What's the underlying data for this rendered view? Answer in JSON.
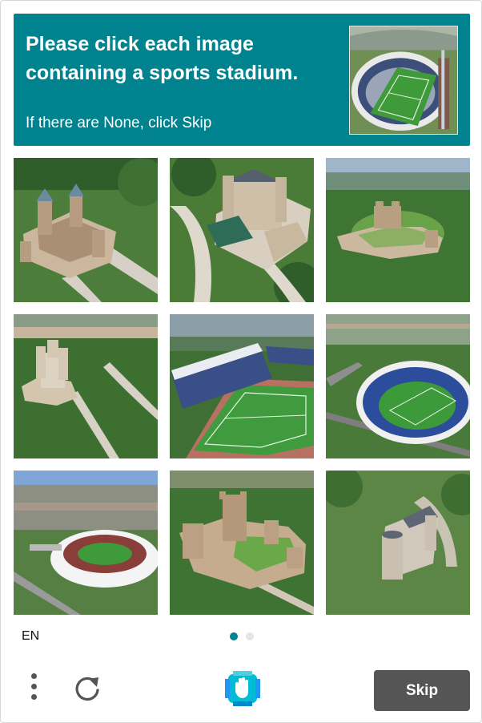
{
  "prompt": {
    "title": "Please click each image containing a sports stadium.",
    "subtitle": "If there are None, click Skip",
    "example_icon": "stadium-example-image"
  },
  "tiles": [
    {
      "subject": "castle",
      "icon": "castle-image"
    },
    {
      "subject": "castle",
      "icon": "castle-image"
    },
    {
      "subject": "castle",
      "icon": "castle-image"
    },
    {
      "subject": "castle",
      "icon": "castle-image"
    },
    {
      "subject": "stadium",
      "icon": "stadium-image"
    },
    {
      "subject": "stadium",
      "icon": "stadium-image"
    },
    {
      "subject": "stadium",
      "icon": "stadium-image"
    },
    {
      "subject": "castle",
      "icon": "castle-image"
    },
    {
      "subject": "castle",
      "icon": "castle-image"
    }
  ],
  "footer": {
    "language": "EN",
    "page_dots": {
      "count": 2,
      "active": 1
    },
    "skip_label": "Skip",
    "menu_icon": "more-vertical-icon",
    "refresh_icon": "refresh-icon",
    "logo_icon": "hcaptcha-logo-icon"
  },
  "colors": {
    "accent": "#00838f",
    "skip_button": "#555555",
    "dot_inactive": "#e6e6e6"
  }
}
